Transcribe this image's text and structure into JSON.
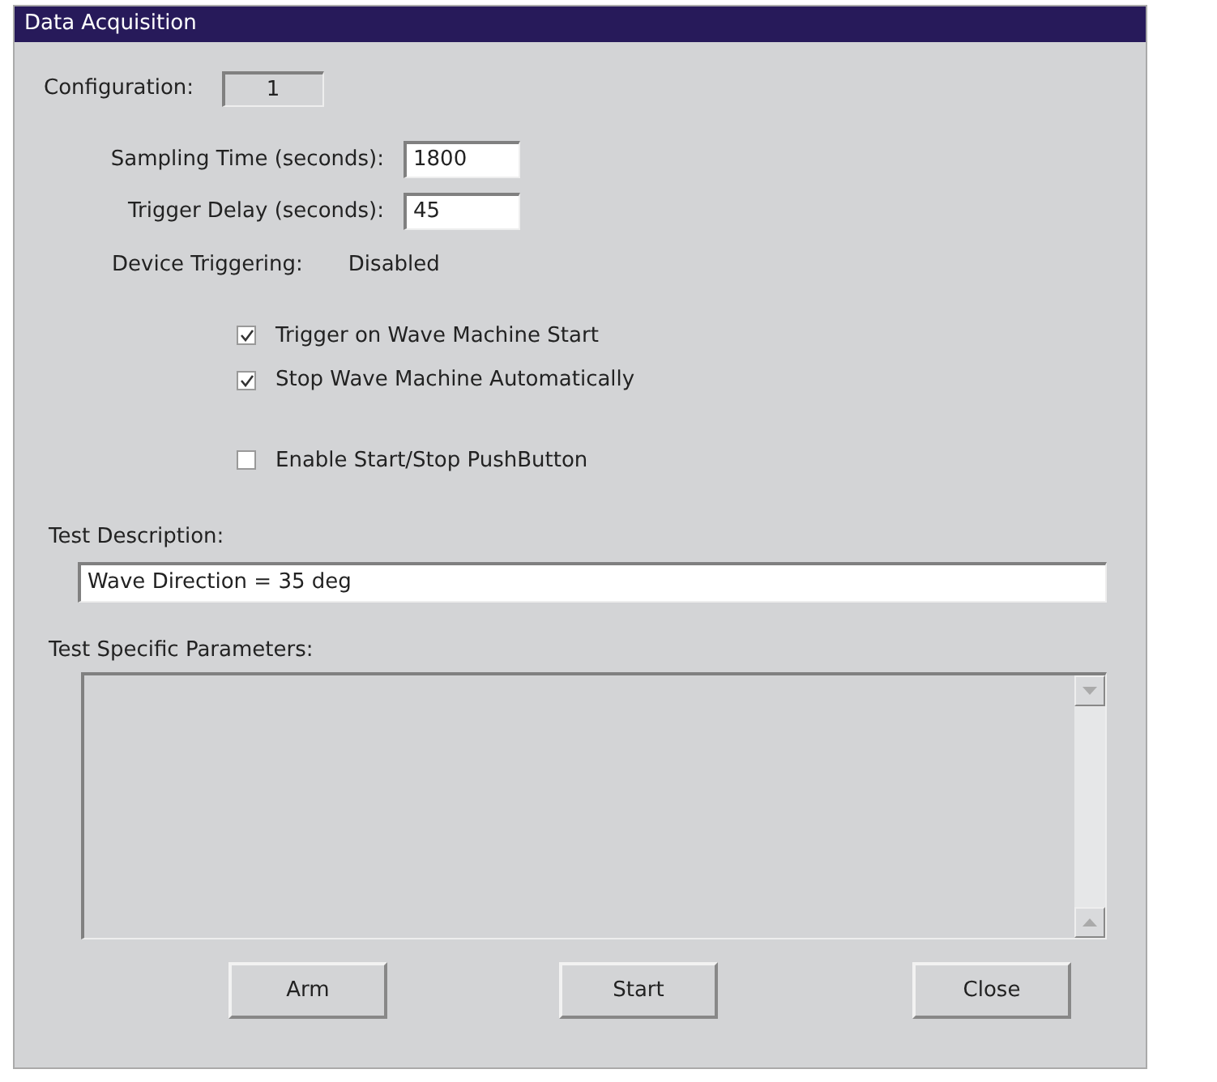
{
  "window": {
    "title": "Data Acquisition"
  },
  "configuration": {
    "label": "Configuration:",
    "value": "1"
  },
  "fields": [
    {
      "label": "Sampling Time (seconds):",
      "value": "1800"
    },
    {
      "label": "Trigger Delay (seconds):",
      "value": "45"
    }
  ],
  "device_triggering": {
    "label": "Device Triggering:",
    "value": "Disabled"
  },
  "checkboxes": [
    {
      "label": "Trigger on Wave Machine Start",
      "checked": true
    },
    {
      "label": "Stop Wave Machine Automatically",
      "checked": true
    },
    {
      "label": "Enable Start/Stop PushButton",
      "checked": false
    }
  ],
  "test_description": {
    "label": "Test Description:",
    "value": "Wave Direction = 35 deg"
  },
  "test_parameters": {
    "label": "Test Specific Parameters:"
  },
  "buttons": [
    "Arm",
    "Start",
    "Close"
  ]
}
